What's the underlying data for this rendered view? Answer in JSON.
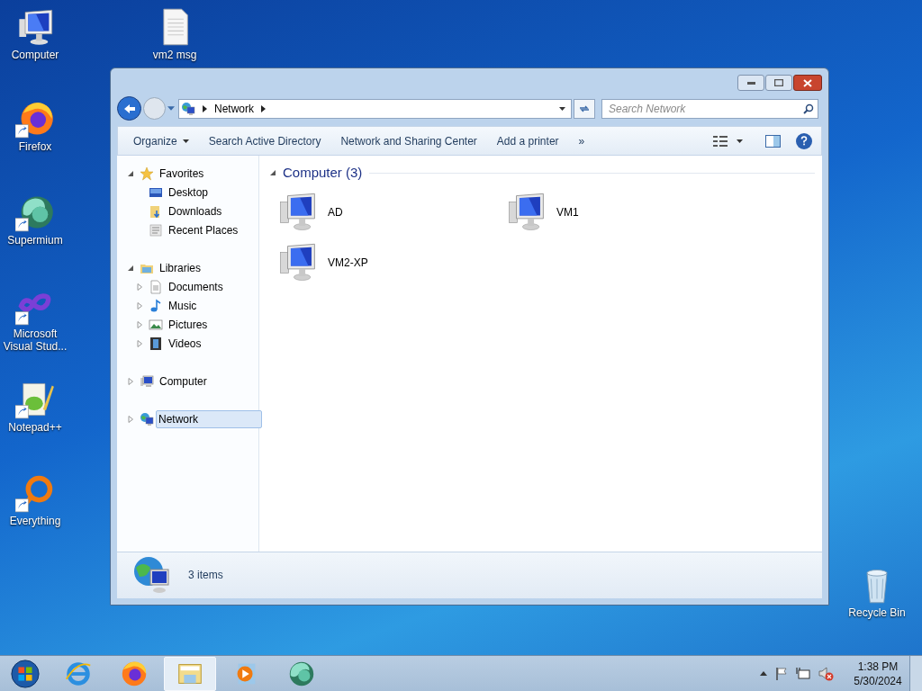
{
  "desktop_icons": [
    {
      "label": "Computer",
      "kind": "computer",
      "shortcut": false
    },
    {
      "label": "vm2 msg",
      "kind": "document",
      "shortcut": false
    },
    {
      "label": "Firefox",
      "kind": "firefox",
      "shortcut": true
    },
    {
      "label": "Supermium",
      "kind": "supermium",
      "shortcut": true
    },
    {
      "label": "Microsoft Visual Stud...",
      "kind": "visualstudio",
      "shortcut": true
    },
    {
      "label": "Notepad++",
      "kind": "notepad",
      "shortcut": true
    },
    {
      "label": "Everything",
      "kind": "everything",
      "shortcut": true
    },
    {
      "label": "Recycle Bin",
      "kind": "recyclebin",
      "shortcut": false
    }
  ],
  "window": {
    "address": {
      "path": [
        "Network"
      ]
    },
    "search": {
      "placeholder": "Search Network"
    },
    "toolbar": [
      {
        "label": "Organize",
        "dropdown": true
      },
      {
        "label": "Search Active Directory",
        "dropdown": false
      },
      {
        "label": "Network and Sharing Center",
        "dropdown": false
      },
      {
        "label": "Add a printer",
        "dropdown": false
      },
      {
        "label": "»",
        "dropdown": false
      }
    ],
    "nav": [
      {
        "label": "Favorites",
        "kind": "favorites",
        "expanded": true,
        "selected": false,
        "children": [
          {
            "label": "Desktop",
            "kind": "desktop",
            "selected": false
          },
          {
            "label": "Downloads",
            "kind": "downloads",
            "selected": false
          },
          {
            "label": "Recent Places",
            "kind": "recent",
            "selected": false
          }
        ]
      },
      {
        "label": "Libraries",
        "kind": "libraries",
        "expanded": true,
        "selected": false,
        "children": [
          {
            "label": "Documents",
            "kind": "documents",
            "expanded": false,
            "selected": false
          },
          {
            "label": "Music",
            "kind": "music",
            "expanded": false,
            "selected": false
          },
          {
            "label": "Pictures",
            "kind": "pictures",
            "expanded": false,
            "selected": false
          },
          {
            "label": "Videos",
            "kind": "videos",
            "expanded": false,
            "selected": false
          }
        ]
      },
      {
        "label": "Computer",
        "kind": "computer",
        "expanded": false,
        "selected": false
      },
      {
        "label": "Network",
        "kind": "network",
        "expanded": false,
        "selected": true
      }
    ],
    "group": {
      "title": "Computer (3)",
      "expanded": true,
      "items": [
        {
          "label": "AD"
        },
        {
          "label": "VM1"
        },
        {
          "label": "VM2-XP"
        }
      ]
    },
    "status": {
      "text": "3 items"
    }
  },
  "taskbar": {
    "items": [
      {
        "kind": "start",
        "selected": false
      },
      {
        "kind": "ie",
        "selected": false
      },
      {
        "kind": "firefox",
        "selected": false
      },
      {
        "kind": "explorer",
        "selected": true
      },
      {
        "kind": "mediaplayer",
        "selected": false
      },
      {
        "kind": "supermium",
        "selected": false
      }
    ],
    "clock": {
      "time": "1:38 PM",
      "date": "5/30/2024"
    }
  }
}
